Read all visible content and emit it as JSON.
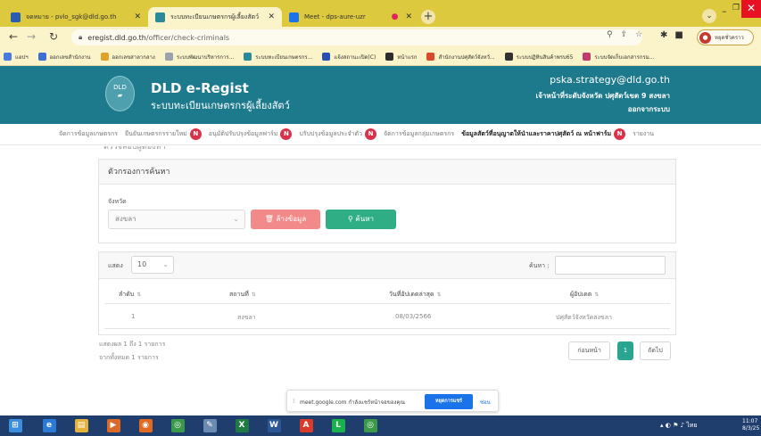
{
  "browser": {
    "tabs": [
      {
        "label": "จดหมาย - pvlo_sgk@dld.go.th",
        "color": "#2a5db0"
      },
      {
        "label": "ระบบทะเบียนเกษตรกรผู้เลี้ยงสัตว์",
        "color": "#2a8a9a"
      },
      {
        "label": "Meet - dps-aure-uzr",
        "color": "#1a73e8"
      }
    ],
    "url_host": "eregist.dld.go.th",
    "url_path": "/officer/check-criminals",
    "profile_label": "หยุดชั่วคราว",
    "bookmarks": [
      {
        "label": "แอปฯ",
        "color": "#4a7be0"
      },
      {
        "label": "ออกเลขสำนักงาน",
        "color": "#3c6fd6"
      },
      {
        "label": "ออกเลขสาลากลาง",
        "color": "#e0a12a"
      },
      {
        "label": "ระบบพัฒนาบริหารการ...",
        "color": "#9aa3ad"
      },
      {
        "label": "ระบบทะเบียนเกษตรกร...",
        "color": "#2a8a9a"
      },
      {
        "label": "แจ้งสถานะเปิด(C)",
        "color": "#2a4fb0"
      },
      {
        "label": "หน้าแรก",
        "color": "#2d2d2d"
      },
      {
        "label": "สำนักงานปศุสัตว์จังหวั...",
        "color": "#d94a2a"
      },
      {
        "label": "ระบบปฏิทินสินค้าพรบ65",
        "color": "#333333"
      },
      {
        "label": "ระบบจัดเก็บเอกสารกรม...",
        "color": "#c43a6a"
      }
    ]
  },
  "header": {
    "logo_text": "DLD",
    "title": "DLD e-Regist",
    "subtitle": "ระบบทะเบียนเกษตรกรผู้เลี้ยงสัตว์",
    "user_email": "pska.strategy@dld.go.th",
    "user_role": "เจ้าหน้าที่ระดับจังหวัด ปศุสัตว์เขต 9 สงขลา",
    "logout": "ออกจากระบบ"
  },
  "nav": {
    "items": [
      {
        "label": "จัดการข้อมูลเกษตรกร",
        "badge": ""
      },
      {
        "label": "ยืนยันเกษตรกรรายใหม่",
        "badge": "N"
      },
      {
        "label": "อนุมัติปรับปรุงข้อมูลฟาร์ม",
        "badge": "N"
      },
      {
        "label": "ปรับปรุงข้อมูลประจำตัว",
        "badge": "N"
      },
      {
        "label": "จัดการข้อมูลกลุ่มเกษตรกร",
        "badge": ""
      },
      {
        "label": "ข้อมูลสัตว์ที่อนุญาตให้นำและราคาปศุสัตว์ ณ หน้าฟาร์ม",
        "badge": "N"
      },
      {
        "label": "รายงาน",
        "badge": ""
      }
    ]
  },
  "page": {
    "clipped_title": "ตรวจสอบผู้ต้องหา"
  },
  "filter": {
    "title": "ตัวกรองการค้นหา",
    "province_label": "จังหวัด",
    "province_value": "สงขลา",
    "clear_label": "ล้างข้อมูล",
    "search_label": "ค้นหา"
  },
  "table": {
    "show_label": "แสดง",
    "page_size": "10",
    "search_label": "ค้นหา :",
    "headers": [
      "ลำดับ",
      "สถานที่",
      "วันที่อัปเดตล่าสุด",
      "ผู้อัปเดต"
    ],
    "rows": [
      [
        "1",
        "สงขลา",
        "08/03/2566",
        "ปศุสัตว์จังหวัดสงขลา"
      ]
    ],
    "info_line1": "แสดงผล 1 ถึง 1 รายการ",
    "info_line2": "จากทั้งหมด 1 รายการ",
    "prev": "ก่อนหน้า",
    "current_page": "1",
    "next": "ถัดไป"
  },
  "meet": {
    "message": "meet.google.com กำลังแชร์หน้าจอของคุณ",
    "stop": "หยุดการแชร์",
    "hide": "ซ่อน"
  },
  "taskbar": {
    "apps": [
      {
        "name": "ie",
        "color": "#2b7bd6",
        "glyph": "e"
      },
      {
        "name": "explorer",
        "color": "#e4b33b",
        "glyph": "▤"
      },
      {
        "name": "media",
        "color": "#d96a2a",
        "glyph": "▶"
      },
      {
        "name": "firefox",
        "color": "#e06a20",
        "glyph": "◉"
      },
      {
        "name": "chrome",
        "color": "#3a9a4a",
        "glyph": "◎"
      },
      {
        "name": "tool",
        "color": "#6b8bb0",
        "glyph": "✎"
      },
      {
        "name": "excel",
        "color": "#1f7a44",
        "glyph": "X"
      },
      {
        "name": "word",
        "color": "#2b5797",
        "glyph": "W"
      },
      {
        "name": "acrobat",
        "color": "#d93a2a",
        "glyph": "A"
      },
      {
        "name": "line",
        "color": "#19b14a",
        "glyph": "L"
      },
      {
        "name": "chrome2",
        "color": "#3a9a4a",
        "glyph": "◎"
      }
    ],
    "lang": "ไทย",
    "time": "11:07",
    "date": "8/3/25"
  }
}
